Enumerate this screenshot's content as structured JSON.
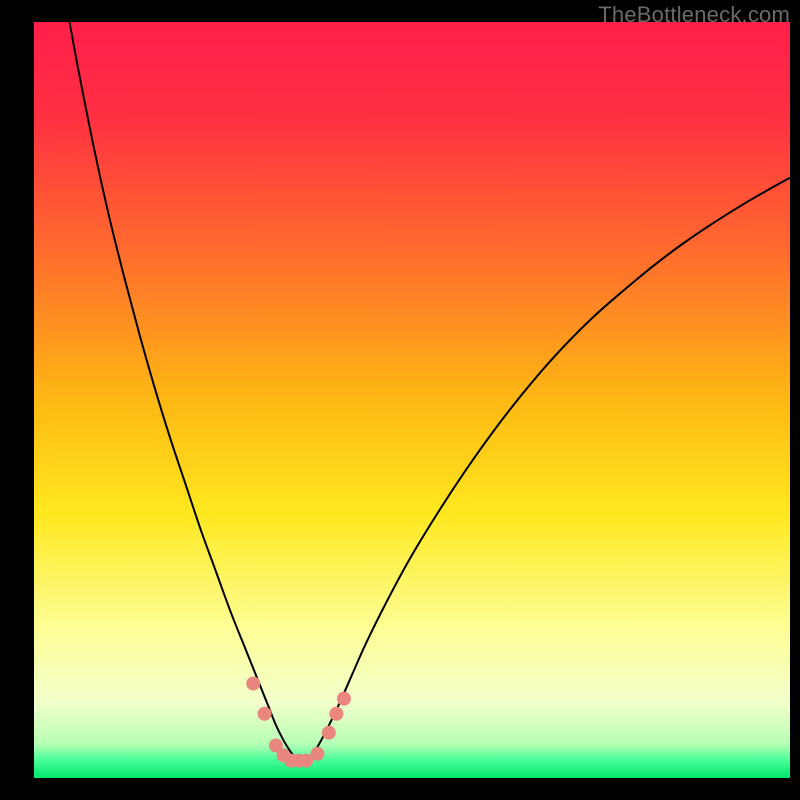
{
  "watermark": "TheBottleneck.com",
  "colors": {
    "gradient_stops": [
      {
        "offset": 0.0,
        "color": "#ff1f4a"
      },
      {
        "offset": 0.12,
        "color": "#ff2f42"
      },
      {
        "offset": 0.3,
        "color": "#ff6a2e"
      },
      {
        "offset": 0.5,
        "color": "#fdb813"
      },
      {
        "offset": 0.65,
        "color": "#ffe81f"
      },
      {
        "offset": 0.8,
        "color": "#fdfe94"
      },
      {
        "offset": 0.9,
        "color": "#f3ffcc"
      },
      {
        "offset": 0.955,
        "color": "#b6ffb5"
      },
      {
        "offset": 0.975,
        "color": "#4dff9a"
      },
      {
        "offset": 1.0,
        "color": "#00e66b"
      }
    ],
    "curve": "#000000",
    "marker_fill": "#e9877f",
    "marker_stroke": "#e9877f"
  },
  "chart_data": {
    "type": "line",
    "title": "",
    "xlabel": "",
    "ylabel": "",
    "xlim": [
      0,
      100
    ],
    "ylim": [
      0,
      100
    ],
    "grid": false,
    "legend": false,
    "series": [
      {
        "name": "bottleneck-curve",
        "x": [
          4.7,
          6,
          8,
          10,
          12,
          14,
          16,
          18,
          20,
          22,
          24,
          26,
          28,
          29,
          30,
          31,
          32,
          33,
          34,
          35,
          36,
          37,
          38,
          40,
          42,
          44,
          47,
          50,
          54,
          58,
          62,
          66,
          70,
          74,
          78,
          82,
          86,
          90,
          94,
          98,
          100
        ],
        "y": [
          100,
          93,
          83,
          74,
          66,
          58.5,
          51.5,
          45,
          39,
          33,
          27.5,
          22,
          17,
          14.5,
          12,
          9.5,
          7,
          5,
          3.4,
          2.3,
          2.3,
          3.4,
          5,
          9,
          13.5,
          18,
          24,
          29.5,
          36,
          42,
          47.5,
          52.5,
          57,
          61,
          64.5,
          67.8,
          70.8,
          73.5,
          76,
          78.3,
          79.4
        ]
      }
    ],
    "markers": [
      {
        "x": 29.0,
        "y": 12.5
      },
      {
        "x": 30.5,
        "y": 8.5
      },
      {
        "x": 32.0,
        "y": 4.3
      },
      {
        "x": 33.0,
        "y": 3.0
      },
      {
        "x": 34.0,
        "y": 2.3
      },
      {
        "x": 35.0,
        "y": 2.3
      },
      {
        "x": 36.0,
        "y": 2.3
      },
      {
        "x": 37.5,
        "y": 3.2
      },
      {
        "x": 39.0,
        "y": 6.0
      },
      {
        "x": 40.0,
        "y": 8.5
      },
      {
        "x": 41.0,
        "y": 10.5
      }
    ]
  }
}
